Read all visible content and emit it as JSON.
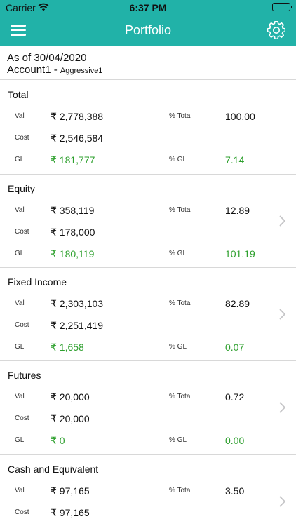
{
  "status_bar": {
    "carrier": "Carrier",
    "time": "6:37 PM"
  },
  "nav": {
    "title": "Portfolio"
  },
  "header": {
    "as_of": "As of 30/04/2020",
    "account": "Account1 -",
    "profile": "Aggressive1"
  },
  "labels": {
    "val": "Val",
    "cost": "Cost",
    "gl": "GL",
    "pct_total": "% Total",
    "pct_gl": "% GL"
  },
  "sections": [
    {
      "title": "Total",
      "val": "₹ 2,778,388",
      "cost": "₹ 2,546,584",
      "gl": "₹ 181,777",
      "pct_total": "100.00",
      "pct_gl": "7.14"
    },
    {
      "title": "Equity",
      "val": "₹ 358,119",
      "cost": "₹ 178,000",
      "gl": "₹ 180,119",
      "pct_total": "12.89",
      "pct_gl": "101.19"
    },
    {
      "title": "Fixed Income",
      "val": "₹ 2,303,103",
      "cost": "₹ 2,251,419",
      "gl": "₹ 1,658",
      "pct_total": "82.89",
      "pct_gl": "0.07"
    },
    {
      "title": "Futures",
      "val": "₹ 20,000",
      "cost": "₹ 20,000",
      "gl": "₹ 0",
      "pct_total": "0.72",
      "pct_gl": "0.00"
    },
    {
      "title": "Cash and Equivalent",
      "val": "₹ 97,165",
      "cost": "₹ 97,165",
      "pct_total": "3.50"
    }
  ],
  "colors": {
    "accent": "#21b2a8",
    "gain": "#2ea02e"
  },
  "icons": [
    "menu-icon",
    "gear-icon",
    "wifi-icon",
    "battery-icon",
    "chevron-right-icon"
  ]
}
